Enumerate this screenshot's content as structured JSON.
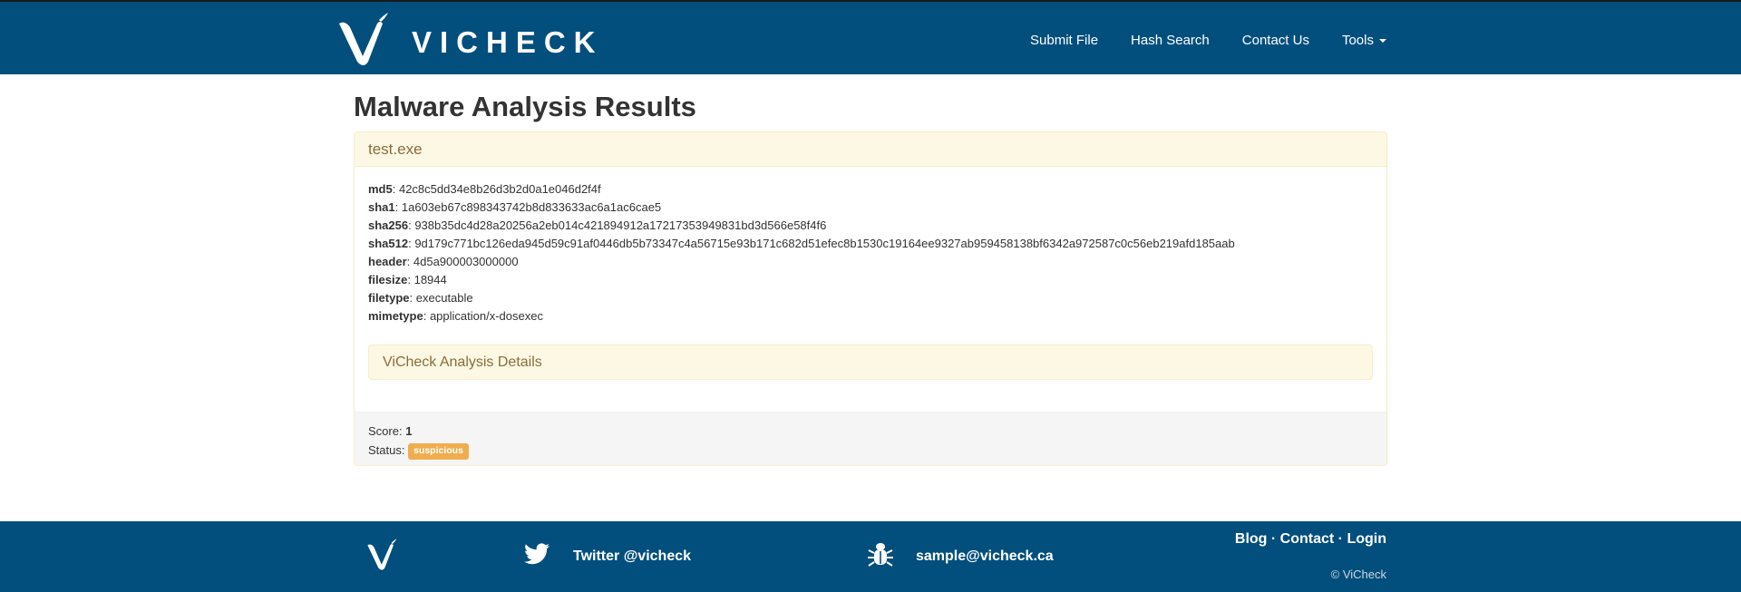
{
  "navbar": {
    "brand": "VICHECK",
    "links": [
      "Submit File",
      "Hash Search",
      "Contact Us",
      "Tools"
    ]
  },
  "main": {
    "title": "Malware Analysis Results",
    "panel": {
      "heading": "test.exe",
      "fields": [
        {
          "key": "md5",
          "value": "42c8c5dd34e8b26d3b2d0a1e046d2f4f"
        },
        {
          "key": "sha1",
          "value": "1a603eb67c898343742b8d833633ac6a1ac6cae5"
        },
        {
          "key": "sha256",
          "value": "938b35dc4d28a20256a2eb014c421894912a17217353949831bd3d566e58f4f6"
        },
        {
          "key": "sha512",
          "value": "9d179c771bc126eda945d59c91af0446db5b73347c4a56715e93b171c682d51efec8b1530c19164ee9327ab959458138bf6342a972587c0c56eb219afd185aab"
        },
        {
          "key": "header",
          "value": "4d5a900003000000"
        },
        {
          "key": "filesize",
          "value": "18944"
        },
        {
          "key": "filetype",
          "value": "executable"
        },
        {
          "key": "mimetype",
          "value": "application/x-dosexec"
        }
      ],
      "details_heading": "ViCheck Analysis Details",
      "score_label": "Score: ",
      "score_value": "1",
      "status_label": "Status: ",
      "status_value": "suspicious",
      "status_color": "#f0ad4e"
    }
  },
  "footer": {
    "twitter": "Twitter @vicheck",
    "email": "sample@vicheck.ca",
    "links": [
      "Blog",
      "Contact",
      "Login"
    ],
    "separator": " · ",
    "copyright": "© ViCheck"
  },
  "colors": {
    "brand_blue": "#024f7d",
    "panel_warning_bg": "#fcf8e3",
    "panel_warning_text": "#8a6d3b"
  },
  "icons": [
    "vicheck-logo-icon",
    "twitter-icon",
    "bug-icon",
    "caret-down-icon"
  ]
}
